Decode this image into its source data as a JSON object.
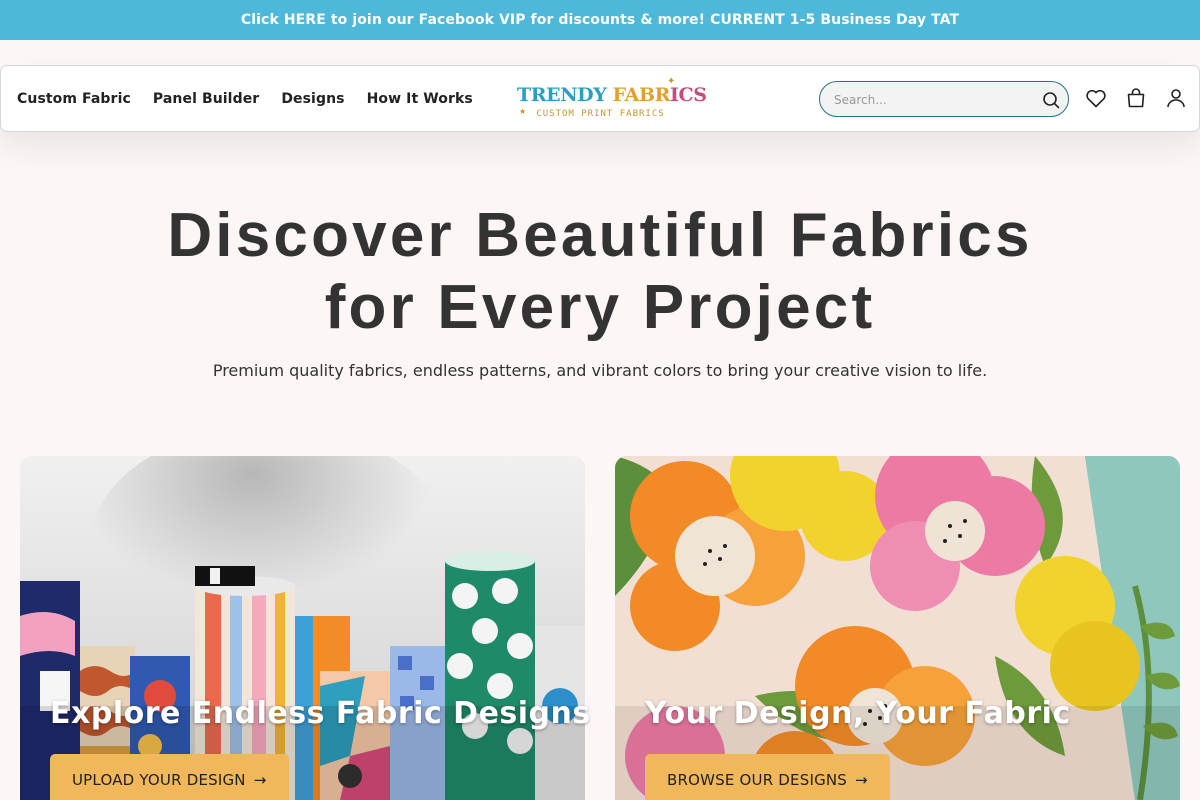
{
  "announcement": "Click HERE to join our Facebook VIP for discounts & more! CURRENT 1-5 Business Day TAT",
  "nav": {
    "items": [
      "Custom Fabric",
      "Panel Builder",
      "Designs",
      "How It Works"
    ]
  },
  "logo": {
    "part1": "TRENDY",
    "part2": "FABR",
    "part3": "ICS",
    "tagline": "CUSTOM PRINT FABRICS"
  },
  "search": {
    "placeholder": "Search...",
    "icon": "search-icon"
  },
  "header_icons": [
    "heart-icon",
    "shopping-bag-icon",
    "user-icon"
  ],
  "hero": {
    "title_line1": "Discover Beautiful Fabrics",
    "title_line2": "for Every Project",
    "subtitle": "Premium quality fabrics, endless patterns, and vibrant colors to bring your creative vision to life."
  },
  "cards": [
    {
      "title": "Explore Endless Fabric Designs",
      "button": "UPLOAD YOUR DESIGN",
      "arrow": "→"
    },
    {
      "title": "Your Design, Your Fabric",
      "button": "BROWSE OUR DESIGNS",
      "arrow": "→"
    }
  ],
  "colors": {
    "announcement_bg": "#4db8d9",
    "button_bg": "#f0b85a",
    "page_bg": "#fdf6f7",
    "logo_blue": "#2a9fc2",
    "logo_gold": "#e0a030",
    "logo_pink": "#c64b7d"
  }
}
